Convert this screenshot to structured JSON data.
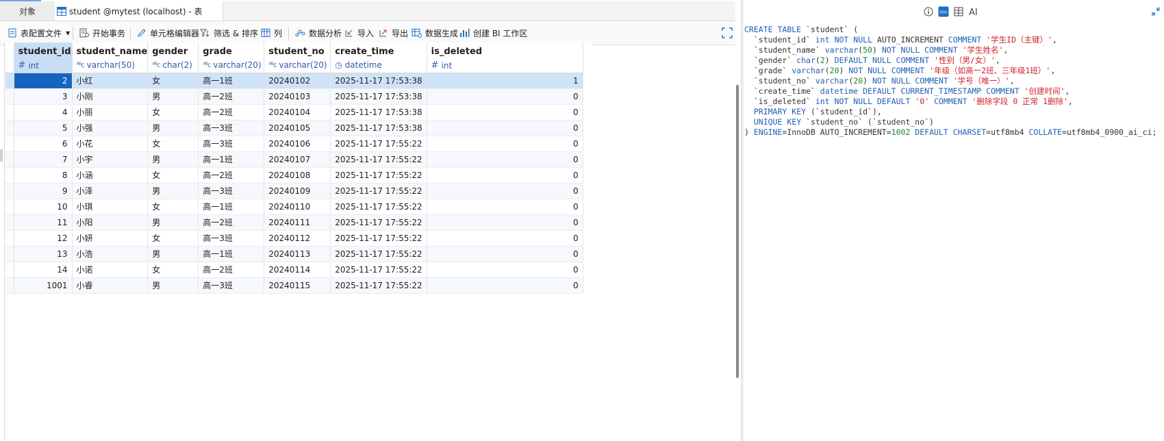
{
  "tabs": {
    "objects": "对象",
    "table": "student @mytest (localhost) - 表"
  },
  "toolbar": {
    "profile": "表配置文件",
    "begin_transaction": "开始事务",
    "cell_editor": "单元格编辑器",
    "filter_sort": "筛选 & 排序",
    "columns": "列",
    "analysis": "数据分析",
    "import": "导入",
    "export": "导出",
    "generate": "数据生成",
    "bi": "创建 BI 工作区"
  },
  "columns": [
    {
      "name": "student_id",
      "type": "int",
      "type_icon": "#"
    },
    {
      "name": "student_name",
      "type": "varchar(50)",
      "type_icon": "ABC"
    },
    {
      "name": "gender",
      "type": "char(2)",
      "type_icon": "ABC"
    },
    {
      "name": "grade",
      "type": "varchar(20)",
      "type_icon": "ABC"
    },
    {
      "name": "student_no",
      "type": "varchar(20)",
      "type_icon": "ABC"
    },
    {
      "name": "create_time",
      "type": "datetime",
      "type_icon": "clock"
    },
    {
      "name": "is_deleted",
      "type": "int",
      "type_icon": "#"
    }
  ],
  "rows": [
    [
      "2",
      "小红",
      "女",
      "高一1班",
      "20240102",
      "2025-11-17 17:53:38",
      "1"
    ],
    [
      "3",
      "小刚",
      "男",
      "高一2班",
      "20240103",
      "2025-11-17 17:53:38",
      "0"
    ],
    [
      "4",
      "小丽",
      "女",
      "高一2班",
      "20240104",
      "2025-11-17 17:53:38",
      "0"
    ],
    [
      "5",
      "小强",
      "男",
      "高一3班",
      "20240105",
      "2025-11-17 17:53:38",
      "0"
    ],
    [
      "6",
      "小花",
      "女",
      "高一3班",
      "20240106",
      "2025-11-17 17:55:22",
      "0"
    ],
    [
      "7",
      "小宇",
      "男",
      "高一1班",
      "20240107",
      "2025-11-17 17:55:22",
      "0"
    ],
    [
      "8",
      "小涵",
      "女",
      "高一2班",
      "20240108",
      "2025-11-17 17:55:22",
      "0"
    ],
    [
      "9",
      "小泽",
      "男",
      "高一3班",
      "20240109",
      "2025-11-17 17:55:22",
      "0"
    ],
    [
      "10",
      "小琪",
      "女",
      "高一1班",
      "20240110",
      "2025-11-17 17:55:22",
      "0"
    ],
    [
      "11",
      "小阳",
      "男",
      "高一2班",
      "20240111",
      "2025-11-17 17:55:22",
      "0"
    ],
    [
      "12",
      "小妍",
      "女",
      "高一3班",
      "20240112",
      "2025-11-17 17:55:22",
      "0"
    ],
    [
      "13",
      "小浩",
      "男",
      "高一1班",
      "20240113",
      "2025-11-17 17:55:22",
      "0"
    ],
    [
      "14",
      "小诺",
      "女",
      "高一2班",
      "20240114",
      "2025-11-17 17:55:22",
      "0"
    ],
    [
      "1001",
      "小睿",
      "男",
      "高一3班",
      "20240115",
      "2025-11-17 17:55:22",
      "0"
    ]
  ],
  "selection": {
    "row": 0,
    "column": 0
  },
  "ddl_panel": {
    "tab_icons": [
      "info-icon",
      "ddl-icon",
      "columns-icon",
      "ai-icon"
    ],
    "ddl_lines": [
      "CREATE TABLE `student` (",
      "  `student_id` int NOT NULL AUTO_INCREMENT COMMENT '学生ID（主键）',",
      "  `student_name` varchar(50) NOT NULL COMMENT '学生姓名',",
      "  `gender` char(2) DEFAULT NULL COMMENT '性别（男/女）',",
      "  `grade` varchar(20) NOT NULL COMMENT '年级（如高一2班、三年级1班）',",
      "  `student_no` varchar(20) NOT NULL COMMENT '学号（唯一）',",
      "  `create_time` datetime DEFAULT CURRENT_TIMESTAMP COMMENT '创建时间',",
      "  `is_deleted` int NOT NULL DEFAULT '0' COMMENT '删除字段 0 正常 1删除',",
      "  PRIMARY KEY (`student_id`),",
      "  UNIQUE KEY `student_no` (`student_no`)",
      ") ENGINE=InnoDB AUTO_INCREMENT=1002 DEFAULT CHARSET=utf8mb4 COLLATE=utf8mb4_0900_ai_ci;"
    ]
  },
  "colors": {
    "selected_cell": "#1565c0",
    "selected_row": "#cfe2f7",
    "keyword": "#1f5fb3",
    "string": "#d1222c",
    "number": "#178a2a"
  }
}
